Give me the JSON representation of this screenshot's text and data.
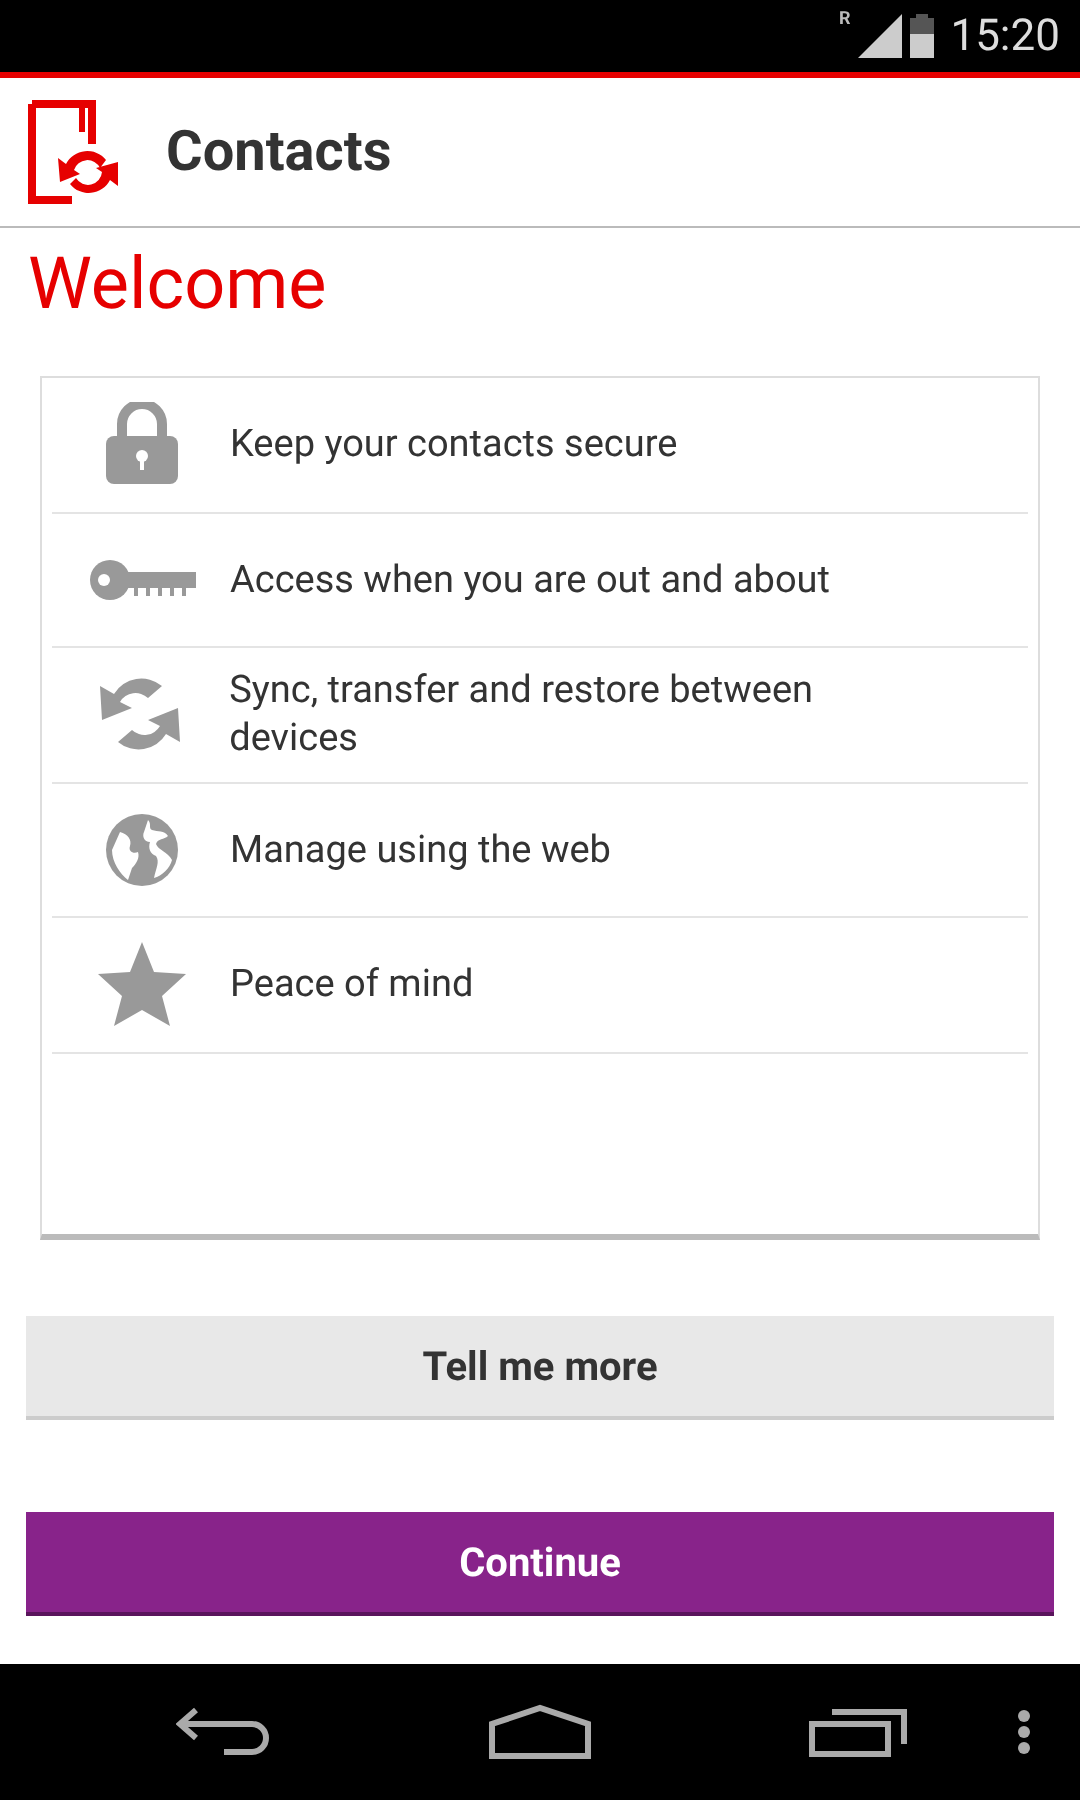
{
  "status_bar": {
    "roaming": "R",
    "time": "15:20"
  },
  "header": {
    "title": "Contacts"
  },
  "heading": "Welcome",
  "features": [
    {
      "kind": "lock",
      "text": "Keep your contacts secure"
    },
    {
      "kind": "key",
      "text": "Access when you are out and about"
    },
    {
      "kind": "sync",
      "text": "Sync, transfer and restore between devices"
    },
    {
      "kind": "globe",
      "text": "Manage using the web"
    },
    {
      "kind": "star",
      "text": "Peace of mind"
    }
  ],
  "buttons": [
    {
      "kind": "secondary",
      "label": "Tell me more"
    },
    {
      "kind": "primary",
      "label": "Continue"
    }
  ]
}
